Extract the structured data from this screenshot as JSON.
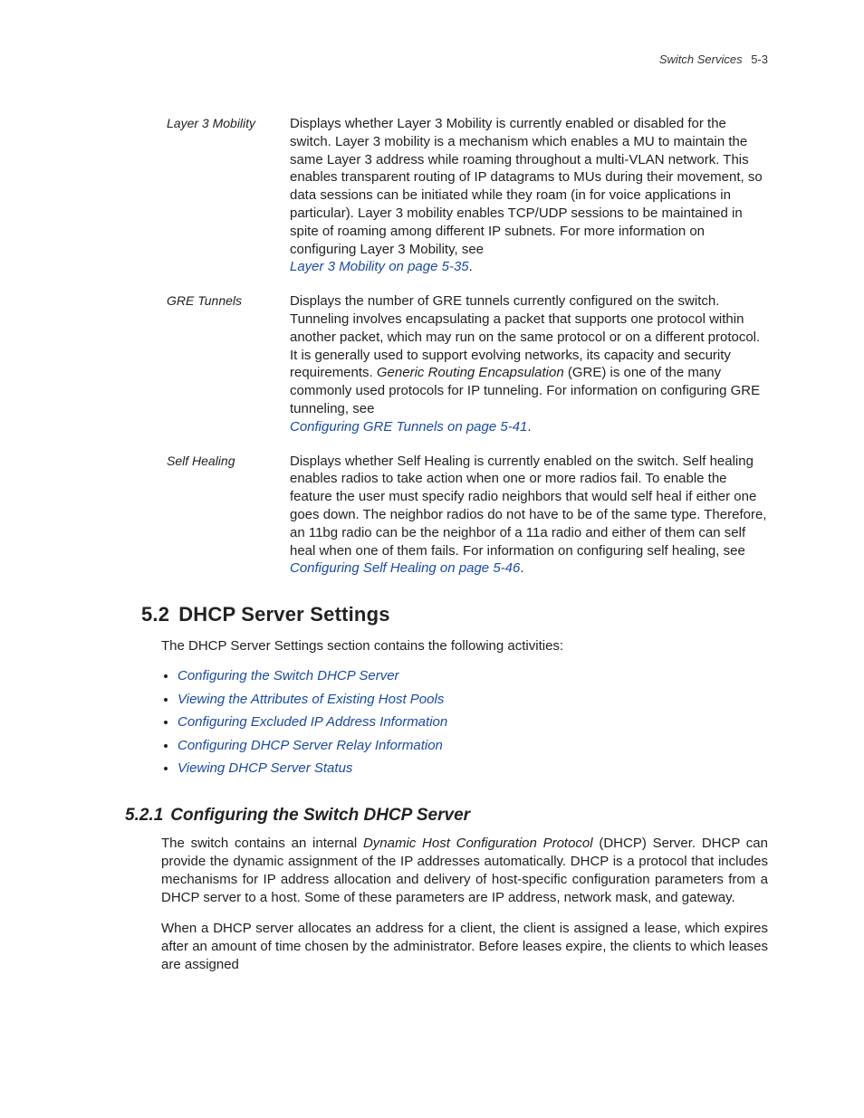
{
  "header": {
    "title": "Switch Services",
    "pagenum": "5-3"
  },
  "defs": {
    "rows": [
      {
        "term": "Layer 3 Mobility",
        "body_pre": "Displays whether Layer 3 Mobility is currently enabled or disabled for the switch. Layer 3 mobility is a mechanism which enables a MU to maintain the same Layer 3 address while roaming throughout a multi-VLAN network. This enables transparent routing of IP datagrams to MUs during their movement, so data sessions can be initiated while they roam (in for voice applications in particular). Layer 3 mobility enables TCP/UDP sessions to be maintained in spite of roaming among different IP subnets. For more information on configuring Layer 3 Mobility, see ",
        "link": "Layer 3 Mobility on page 5-35",
        "link_suffix": "."
      },
      {
        "term": "GRE Tunnels",
        "body_pre": "Displays the number of GRE tunnels currently configured on the switch. Tunneling involves encapsulating a packet that supports one protocol within another packet, which may run on the same protocol or on a different protocol. It is generally used to support evolving networks, its capacity and security requirements. ",
        "ital1": "Generic Routing Encapsulation",
        "body_mid": " (GRE) is one of the many commonly used protocols for IP tunneling. For information on configuring GRE tunneling, see ",
        "link": "Configuring GRE Tunnels on page 5-41",
        "link_suffix": "."
      },
      {
        "term": "Self Healing",
        "body_pre": "Displays whether Self Healing is currently enabled on the switch. Self healing enables radios to take action when one or more radios fail. To enable the feature the user must specify radio neighbors that would self heal if either one goes down. The neighbor radios do not have to be of the same type. Therefore, an 11bg radio can be the neighbor of a 11a radio and either of them can self heal when one of them fails. For information on configuring self healing, see ",
        "link": "Configuring Self Healing on page 5-46",
        "link_suffix": "."
      }
    ]
  },
  "section": {
    "num": "5.2",
    "title": "DHCP Server Settings",
    "intro": "The DHCP Server Settings section contains the following activities:",
    "links": [
      "Configuring the Switch DHCP Server",
      "Viewing the Attributes of Existing Host Pools",
      "Configuring Excluded IP Address Information",
      "Configuring DHCP Server Relay Information",
      "Viewing DHCP Server Status"
    ]
  },
  "subsection": {
    "num": "5.2.1",
    "title": "Configuring the Switch DHCP Server",
    "p1_pre": "The switch contains an internal ",
    "p1_ital": "Dynamic Host Configuration Protocol",
    "p1_post": " (DHCP) Server. DHCP can provide the dynamic assignment of the IP addresses automatically. DHCP is a protocol that includes mechanisms for IP address allocation and delivery of host-specific configuration parameters from a DHCP server to a host. Some of these parameters are IP address, network mask, and gateway.",
    "p2": "When a DHCP server allocates an address for a client, the client is assigned a lease, which expires after an amount of time chosen by the administrator. Before leases expire, the clients to which leases are assigned"
  }
}
